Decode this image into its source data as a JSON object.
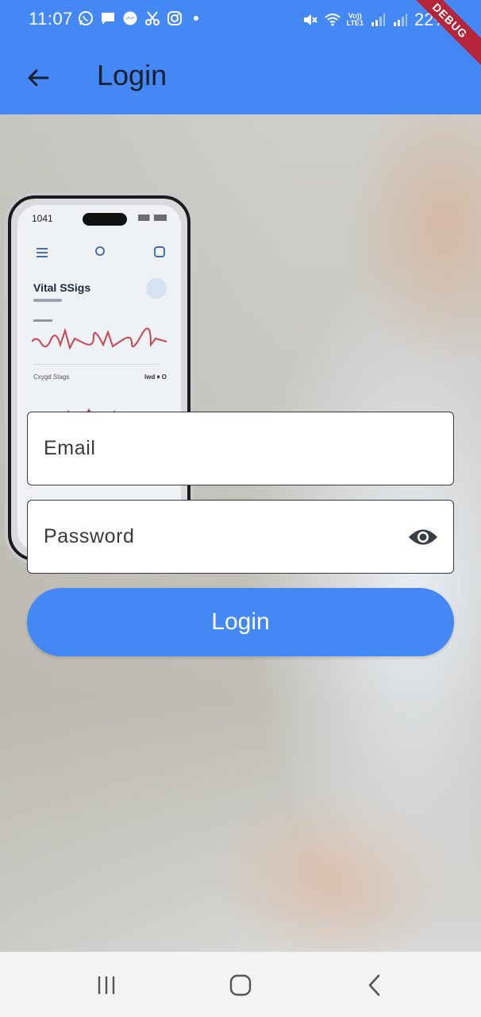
{
  "status_bar": {
    "time": "11:07",
    "battery": "22%",
    "network_label_top": "Vo))",
    "network_label_bottom": "LTE1",
    "left_icons": [
      "whatsapp-icon",
      "message-icon",
      "messenger-icon",
      "scissors-icon",
      "instagram-icon",
      "notification-dot-icon"
    ],
    "right_icons": [
      "mute-icon",
      "wifi-icon",
      "signal-icon",
      "signal-icon",
      "battery-icon"
    ]
  },
  "debug_banner": "DEBUG",
  "app_bar": {
    "title": "Login",
    "back_icon": "arrow-back-icon"
  },
  "hero": {
    "phone_time": "1041",
    "phone_title": "Vital SSigs",
    "phone_section": "Cxygd Stags",
    "phone_section_value": "lwd  ⏸ O"
  },
  "form": {
    "email_placeholder": "Email",
    "email_value": "",
    "password_placeholder": "Password",
    "password_value": "",
    "visibility_icon": "eye-icon",
    "login_label": "Login"
  },
  "nav_bar": {
    "recents_icon": "recents-icon",
    "home_icon": "home-icon",
    "back_icon": "nav-back-icon"
  },
  "colors": {
    "primary": "#4488f6",
    "title_text": "#1a1f2e",
    "field_border": "#3a3a3a",
    "nav_bg": "#f4f4f4",
    "debug": "#b4243a"
  }
}
